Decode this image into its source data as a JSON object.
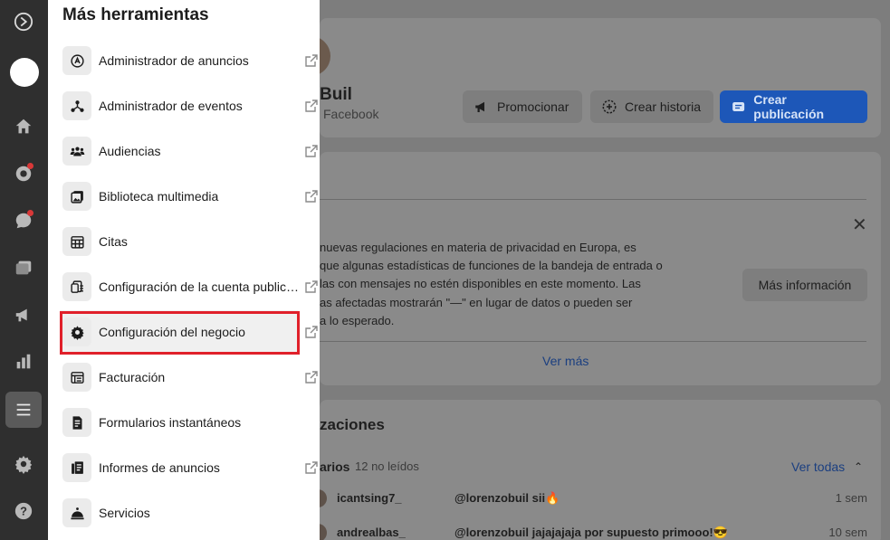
{
  "drawer": {
    "title": "Más herramientas",
    "items": [
      {
        "label": "Administrador de anuncios",
        "icon": "ads-manager-icon"
      },
      {
        "label": "Administrador de eventos",
        "icon": "events-manager-icon"
      },
      {
        "label": "Audiencias",
        "icon": "audiences-icon"
      },
      {
        "label": "Biblioteca multimedia",
        "icon": "media-library-icon"
      },
      {
        "label": "Citas",
        "icon": "calendar-icon"
      },
      {
        "label": "Configuración de la cuenta publicitaria",
        "icon": "ad-account-icon"
      },
      {
        "label": "Configuración del negocio",
        "icon": "gear-icon",
        "highlighted": true
      },
      {
        "label": "Facturación",
        "icon": "billing-icon"
      },
      {
        "label": "Formularios instantáneos",
        "icon": "forms-icon"
      },
      {
        "label": "Informes de anuncios",
        "icon": "ad-reports-icon"
      },
      {
        "label": "Servicios",
        "icon": "services-icon"
      }
    ]
  },
  "rail": {
    "icons": [
      "meta-logo-icon",
      "avatar",
      "home-icon",
      "notifications-icon",
      "messages-icon",
      "content-icon",
      "ads-icon",
      "insights-icon",
      "menu-icon",
      "settings-icon",
      "help-icon"
    ]
  },
  "profile": {
    "name": "Buil",
    "subtitle": "Facebook",
    "buttons": {
      "promote": "Promocionar",
      "story": "Crear historia",
      "post": "Crear publicación"
    }
  },
  "notice": {
    "text": "nuevas regulaciones en materia de privacidad en Europa, es\nque algunas estadísticas de funciones de la bandeja de entrada o\nlas con mensajes no estén disponibles en este momento. Las\nas afectadas mostrarán \"—\" en lugar de datos o pueden ser\na lo esperado.",
    "more_button": "Más información",
    "see_more": "Ver más"
  },
  "updates": {
    "title": "zaciones",
    "messages_label": "arios",
    "unread": "12 no leídos",
    "see_all": "Ver todas",
    "rows": [
      {
        "user": "icantsing7_",
        "message": "@lorenzobuil sii🔥",
        "time": "1 sem"
      },
      {
        "user": "andrealbas_",
        "message": "@lorenzobuil jajajajaja por supuesto primooo!😎",
        "time": "10 sem"
      }
    ]
  },
  "colors": {
    "highlight_border": "#e0202a",
    "primary": "#1877f2"
  }
}
